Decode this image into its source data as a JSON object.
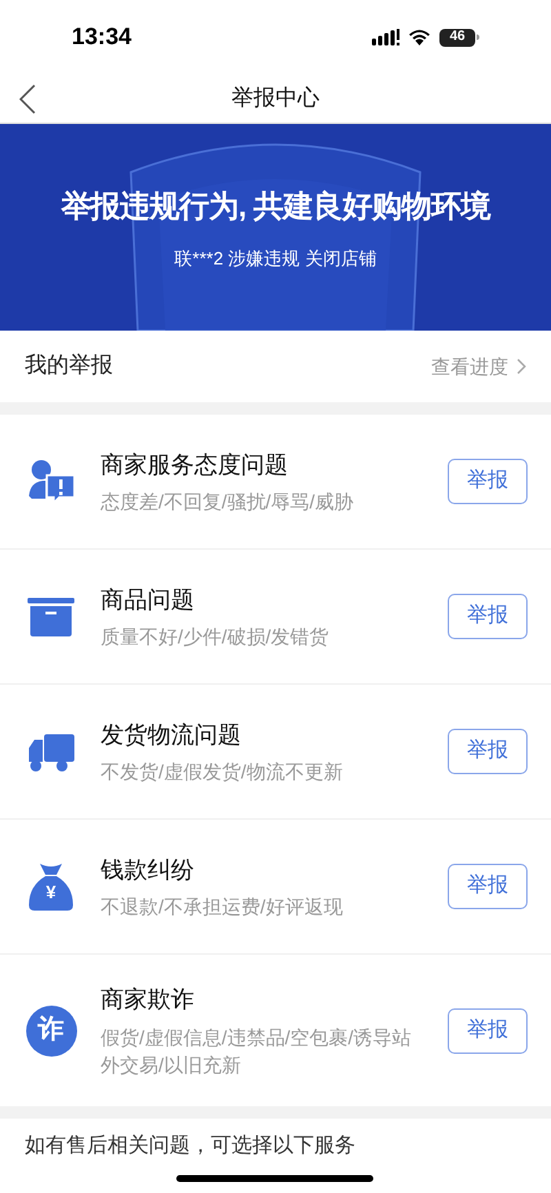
{
  "status_bar": {
    "time": "13:34",
    "battery": "46"
  },
  "nav": {
    "title": "举报中心"
  },
  "banner": {
    "headline": "举报违规行为, 共建良好购物环境",
    "notice": "联***2 涉嫌违规 关闭店铺"
  },
  "my_reports": {
    "label": "我的举报",
    "link": "查看进度"
  },
  "categories": [
    {
      "kind": "service",
      "title": "商家服务态度问题",
      "detail": "态度差/不回复/骚扰/辱骂/威胁",
      "button": "举报"
    },
    {
      "kind": "goods",
      "title": "商品问题",
      "detail": "质量不好/少件/破损/发错货",
      "button": "举报"
    },
    {
      "kind": "shipping",
      "title": "发货物流问题",
      "detail": "不发货/虚假发货/物流不更新",
      "button": "举报"
    },
    {
      "kind": "money",
      "glyph": "¥",
      "title": "钱款纠纷",
      "detail": "不退款/不承担运费/好评返现",
      "button": "举报"
    },
    {
      "kind": "fraud",
      "glyph": "诈",
      "title": "商家欺诈",
      "detail": "假货/虚假信息/违禁品/空包裹/诱导站外交易/以旧充新",
      "button": "举报"
    }
  ],
  "footer": {
    "text": "如有售后相关问题，可选择以下服务"
  }
}
